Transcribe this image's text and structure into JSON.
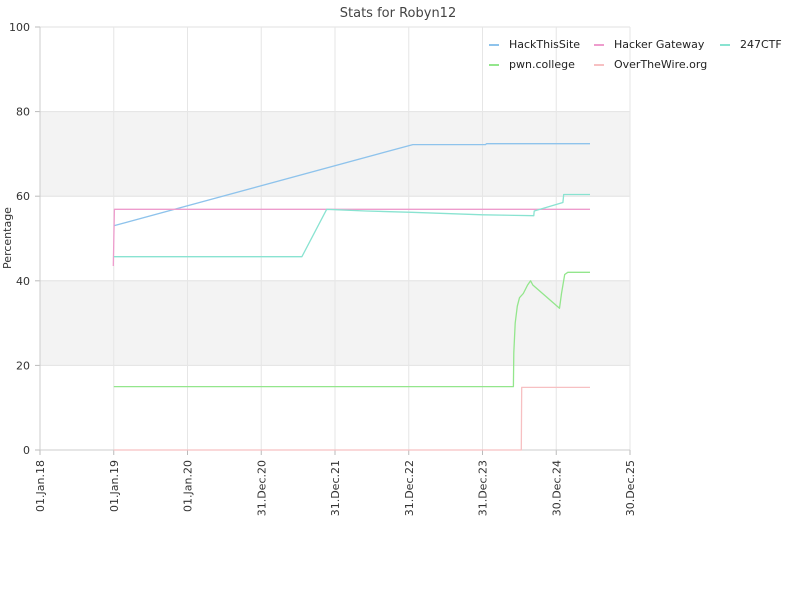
{
  "chart_data": {
    "type": "line",
    "title": "Stats for Robyn12",
    "xlabel": "",
    "ylabel": "Percentage",
    "ylim": [
      0,
      100
    ],
    "xlim": [
      "2018-01-01",
      "2025-12-30"
    ],
    "yticks": [
      0,
      20,
      40,
      60,
      80,
      100
    ],
    "xticks": [
      {
        "date": "2018-01-01",
        "label": "01.Jan.18"
      },
      {
        "date": "2019-01-01",
        "label": "01.Jan.19"
      },
      {
        "date": "2020-01-01",
        "label": "01.Jan.20"
      },
      {
        "date": "2020-12-31",
        "label": "31.Dec.20"
      },
      {
        "date": "2021-12-31",
        "label": "31.Dec.21"
      },
      {
        "date": "2022-12-31",
        "label": "31.Dec.22"
      },
      {
        "date": "2023-12-31",
        "label": "31.Dec.23"
      },
      {
        "date": "2024-12-30",
        "label": "30.Dec.24"
      },
      {
        "date": "2025-12-30",
        "label": "30.Dec.25"
      }
    ],
    "grid": true,
    "bands": [
      [
        20,
        40
      ],
      [
        60,
        80
      ]
    ],
    "band_color": "#f3f3f3",
    "legend_position": "top-right",
    "series": [
      {
        "name": "HackThisSite",
        "color": "#8ec3ec",
        "points": [
          [
            "2019-01-01",
            53
          ],
          [
            "2023-01-20",
            72.2
          ],
          [
            "2024-01-15",
            72.2
          ],
          [
            "2024-01-20",
            72.4
          ],
          [
            "2025-06-15",
            72.4
          ]
        ]
      },
      {
        "name": "Hacker Gateway",
        "color": "#ee9ccd",
        "points": [
          [
            "2018-12-30",
            43.5
          ],
          [
            "2019-01-04",
            56.9
          ],
          [
            "2025-06-15",
            56.9
          ]
        ]
      },
      {
        "name": "247CTF",
        "color": "#89e3d1",
        "points": [
          [
            "2019-01-01",
            45.7
          ],
          [
            "2021-07-20",
            45.7
          ],
          [
            "2021-11-20",
            56.9
          ],
          [
            "2022-06-01",
            56.5
          ],
          [
            "2023-01-15",
            56.2
          ],
          [
            "2024-01-01",
            55.6
          ],
          [
            "2024-09-10",
            55.4
          ],
          [
            "2024-09-12",
            56.5
          ],
          [
            "2025-02-01",
            58.5
          ],
          [
            "2025-02-05",
            60.4
          ],
          [
            "2025-06-15",
            60.4
          ]
        ]
      },
      {
        "name": "pwn.college",
        "color": "#93e68c",
        "points": [
          [
            "2019-01-01",
            15
          ],
          [
            "2024-06-01",
            15
          ],
          [
            "2024-06-03",
            23
          ],
          [
            "2024-06-10",
            30
          ],
          [
            "2024-06-20",
            34
          ],
          [
            "2024-07-01",
            36
          ],
          [
            "2024-07-20",
            37
          ],
          [
            "2024-08-10",
            39
          ],
          [
            "2024-08-25",
            40
          ],
          [
            "2024-09-05",
            39
          ],
          [
            "2025-01-15",
            33.5
          ],
          [
            "2025-01-25",
            37
          ],
          [
            "2025-02-10",
            41.5
          ],
          [
            "2025-02-25",
            42
          ],
          [
            "2025-06-15",
            42
          ]
        ]
      },
      {
        "name": "OverTheWire.org",
        "color": "#f7c0c2",
        "points": [
          [
            "2019-01-01",
            0
          ],
          [
            "2024-07-10",
            0
          ],
          [
            "2024-07-12",
            14.8
          ],
          [
            "2025-06-15",
            14.8
          ]
        ]
      }
    ]
  }
}
